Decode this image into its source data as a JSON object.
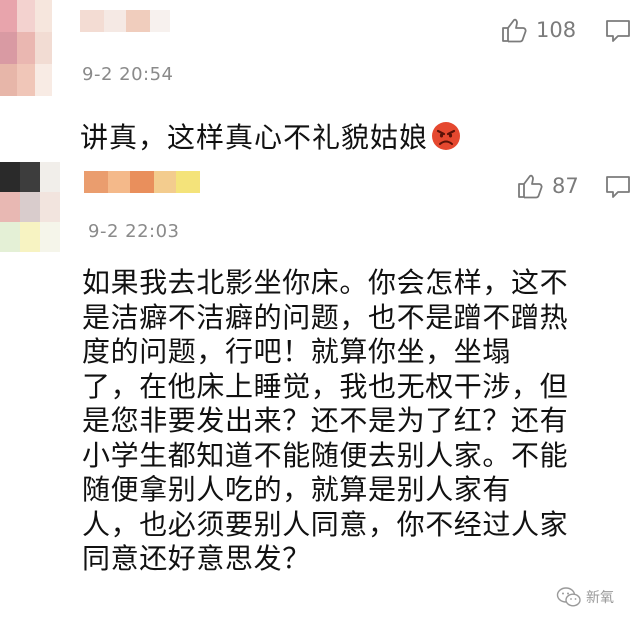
{
  "comments": [
    {
      "timestamp": "9-2 20:54",
      "likes": "108",
      "text": "讲真，这样真心不礼貌姑娘",
      "emoji": "angry-face-icon"
    },
    {
      "timestamp": "9-2 22:03",
      "likes": "87",
      "text": "如果我去北影坐你床。你会怎样，这不\n是洁癖不洁癖的问题，也不是蹭不蹭热\n度的问题，行吧！就算你坐，坐塌\n了，在他床上睡觉，我也无权干涉，但\n是您非要发出来？还不是为了红？还有\n小学生都知道不能随便去别人家。不能\n随便拿别人吃的，就算是别人家有\n人，也必须要别人同意，你不经过人家\n同意还好意思发？"
    }
  ],
  "watermark": {
    "text": "新氧",
    "icon": "wechat-logo-icon"
  },
  "colors": {
    "text": "#111111",
    "meta": "#8a8a8a",
    "icon": "#7b7b7b",
    "emoji": "#e5482f"
  }
}
